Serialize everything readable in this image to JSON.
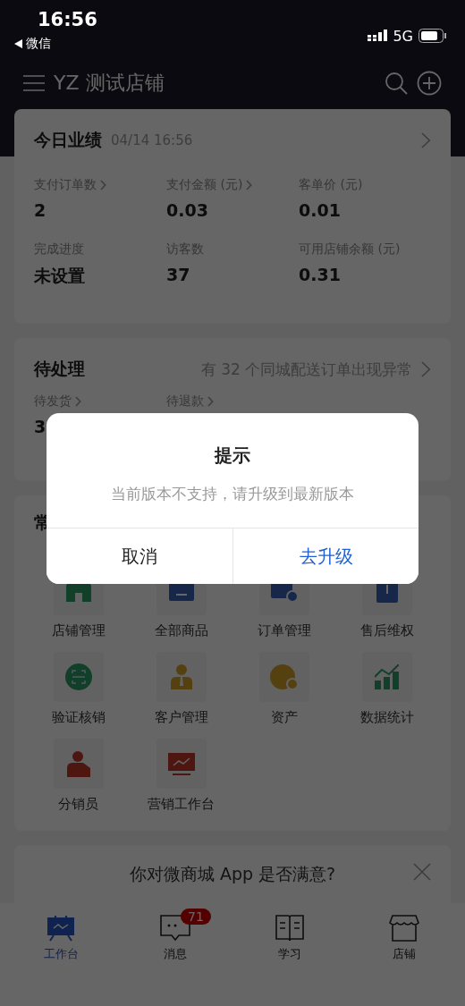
{
  "status_bar": {
    "time": "16:56",
    "back_label": "微信",
    "network": "5G"
  },
  "nav": {
    "title": "YZ 测试店铺"
  },
  "performance": {
    "title": "今日业绩",
    "timestamp": "04/14 16:56",
    "metrics": [
      {
        "label": "支付订单数",
        "has_arrow": true,
        "value": "2"
      },
      {
        "label": "支付金额 (元)",
        "has_arrow": true,
        "value": "0.03"
      },
      {
        "label": "客单价 (元)",
        "has_arrow": false,
        "value": "0.01"
      },
      {
        "label": "完成进度",
        "has_arrow": false,
        "value": "未设置"
      },
      {
        "label": "访客数",
        "has_arrow": false,
        "value": "37"
      },
      {
        "label": "可用店铺余额 (元)",
        "has_arrow": false,
        "value": "0.31"
      }
    ]
  },
  "pending": {
    "title": "待处理",
    "alert": "有 32 个同城配送订单出现异常",
    "items": [
      {
        "label": "待发货",
        "has_arrow": true,
        "value": "3"
      },
      {
        "label": "待退款",
        "has_arrow": true
      }
    ]
  },
  "tools": {
    "title": "常",
    "items": [
      {
        "label": "店铺管理"
      },
      {
        "label": "全部商品"
      },
      {
        "label": "订单管理"
      },
      {
        "label": "售后维权"
      },
      {
        "label": "验证核销"
      },
      {
        "label": "客户管理"
      },
      {
        "label": "资产"
      },
      {
        "label": "数据统计"
      },
      {
        "label": "分销员"
      },
      {
        "label": "营销工作台"
      }
    ]
  },
  "survey": {
    "question": "你对微商城 App 是否满意?"
  },
  "tabs": [
    {
      "label": "工作台",
      "selected": true
    },
    {
      "label": "消息",
      "selected": false,
      "badge": "71"
    },
    {
      "label": "学习",
      "selected": false
    },
    {
      "label": "店铺",
      "selected": false
    }
  ],
  "dialog": {
    "title": "提示",
    "message": "当前版本不支持，请升级到最新版本",
    "buttons": [
      {
        "label": "取消",
        "kind": "cancel"
      },
      {
        "label": "去升级",
        "kind": "primary"
      }
    ]
  }
}
